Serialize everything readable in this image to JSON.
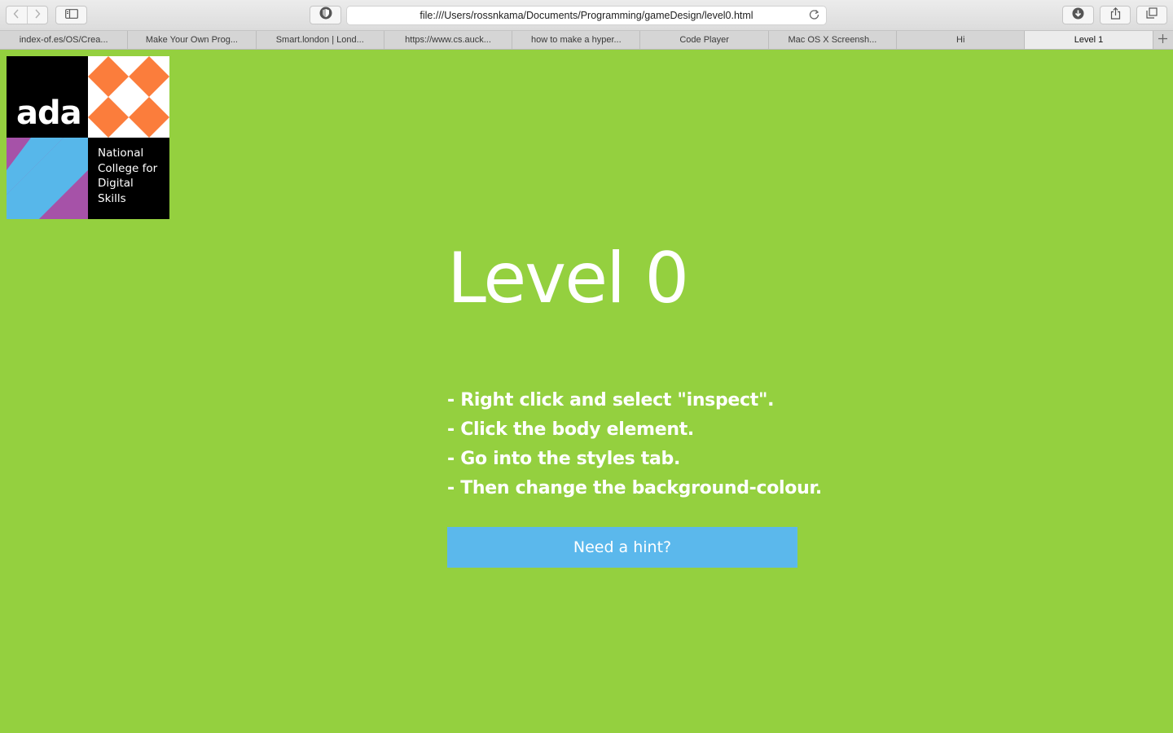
{
  "browser": {
    "url": "file:///Users/rossnkama/Documents/Programming/gameDesign/level0.html",
    "icons": {
      "back": "chevron-left-icon",
      "forward": "chevron-right-icon",
      "sidebar": "sidebar-icon",
      "privacy": "shield-icon",
      "reload": "reload-icon",
      "download": "download-icon",
      "share": "share-icon",
      "tabs": "tabs-overview-icon",
      "new_tab": "plus-icon"
    },
    "tabs": [
      {
        "label": "index-of.es/OS/Crea..."
      },
      {
        "label": "Make Your Own Prog..."
      },
      {
        "label": "Smart.london | Lond..."
      },
      {
        "label": "https://www.cs.auck..."
      },
      {
        "label": "how to make a hyper..."
      },
      {
        "label": "Code Player"
      },
      {
        "label": "Mac OS X Screensh..."
      },
      {
        "label": "Hi"
      },
      {
        "label": "Level 1"
      }
    ],
    "active_tab": 8
  },
  "page": {
    "background": "#94d03f",
    "logo": {
      "brand": "ada",
      "college": "National College for Digital Skills",
      "college_lines": [
        "National",
        "College for",
        "Digital",
        "Skills"
      ],
      "colors": {
        "black": "#000000",
        "orange": "#fb7d3c",
        "blue": "#57b7ea",
        "purple": "#a652a8",
        "white": "#ffffff"
      }
    },
    "title": "Level 0",
    "instructions": [
      "- Right click and select \"inspect\".",
      "- Click the body element.",
      "- Go into the styles tab.",
      "- Then change the background-colour."
    ],
    "hint_button": {
      "label": "Need a hint?",
      "color": "#5bb8ec"
    }
  }
}
